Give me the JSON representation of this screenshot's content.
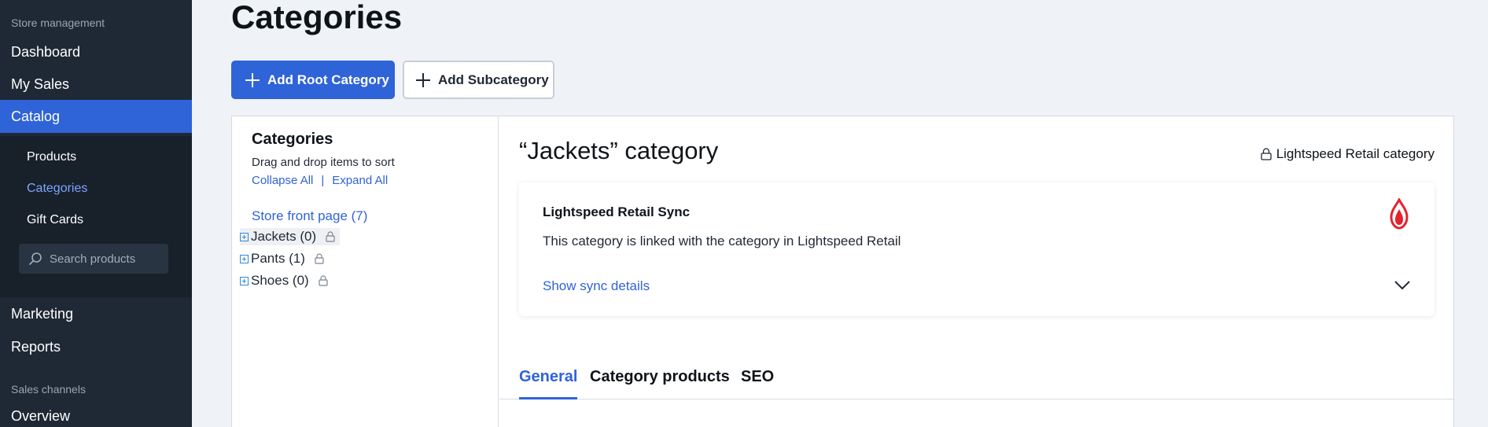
{
  "sidebar": {
    "section_store": "Store management",
    "dashboard": "Dashboard",
    "my_sales": "My Sales",
    "catalog": "Catalog",
    "products": "Products",
    "categories": "Categories",
    "gift_cards": "Gift Cards",
    "search_placeholder": "Search products",
    "marketing": "Marketing",
    "reports": "Reports",
    "section_channels": "Sales channels",
    "overview": "Overview"
  },
  "page": {
    "title": "Categories",
    "add_root_label": "Add Root Category",
    "add_sub_label": "Add Subcategory"
  },
  "tree": {
    "title": "Categories",
    "hint": "Drag and drop items to sort",
    "collapse_all": "Collapse All",
    "separator": "|",
    "expand_all": "Expand All",
    "root": "Store front page (7)",
    "items": [
      {
        "label": "Jackets (0)"
      },
      {
        "label": "Pants (1)"
      },
      {
        "label": "Shoes (0)"
      }
    ]
  },
  "detail": {
    "title": "“Jackets” category",
    "badge": "Lightspeed Retail category",
    "sync": {
      "title": "Lightspeed Retail Sync",
      "text": "This category is linked with the category in Lightspeed Retail",
      "link": "Show sync details"
    },
    "tabs": [
      {
        "label": "General"
      },
      {
        "label": "Category products"
      },
      {
        "label": "SEO"
      }
    ]
  },
  "colors": {
    "accent": "#2f63d8",
    "sidebar_bg": "#1f2935",
    "brand_red": "#e4232c"
  }
}
